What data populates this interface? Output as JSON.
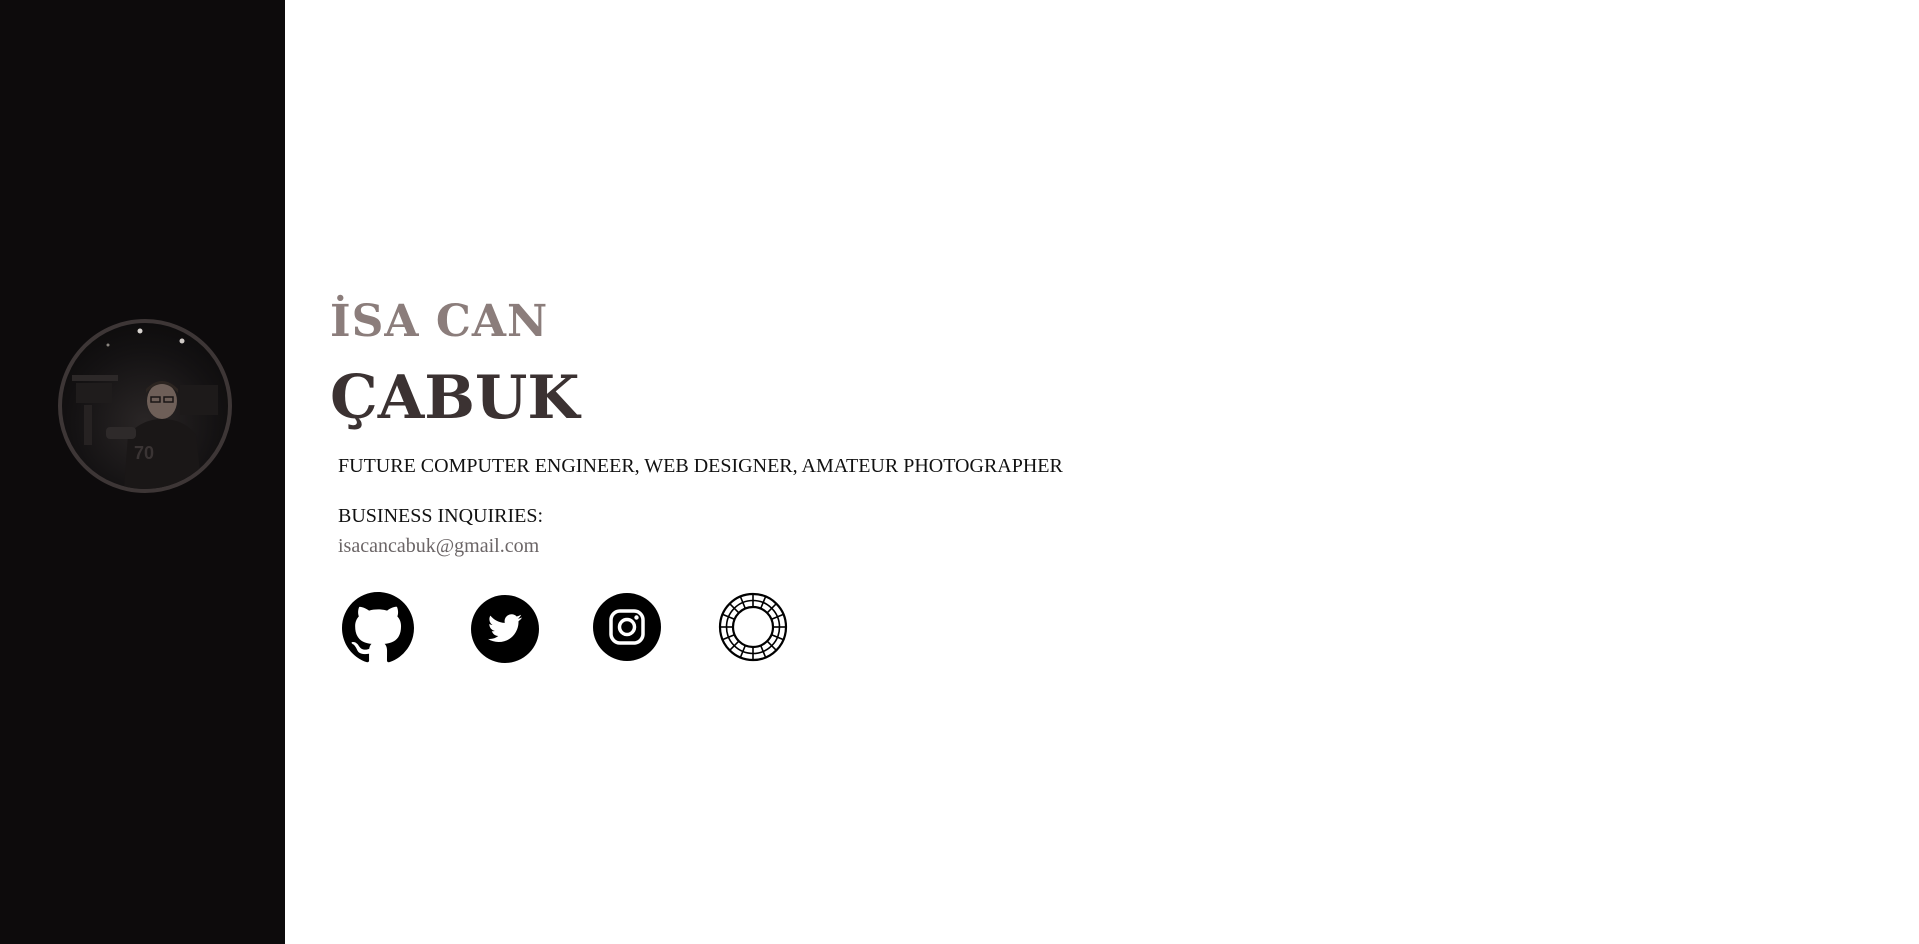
{
  "profile": {
    "first_name": "İSA CAN",
    "last_name": "ÇABUK",
    "tagline": "FUTURE COMPUTER ENGINEER, WEB DESIGNER, AMATEUR PHOTOGRAPHER",
    "inquiries_label": "BUSINESS INQUIRIES:",
    "email": "isacancabuk@gmail.com"
  },
  "socials": [
    {
      "icon": "github-icon"
    },
    {
      "icon": "twitter-icon"
    },
    {
      "icon": "instagram-icon"
    },
    {
      "icon": "vsco-icon"
    }
  ],
  "colors": {
    "sidebar_bg": "#0d0b0c",
    "first_name": "#8b7d7b",
    "last_name": "#3b3232",
    "avatar_border": "#3d3636",
    "email": "#6b6566"
  }
}
